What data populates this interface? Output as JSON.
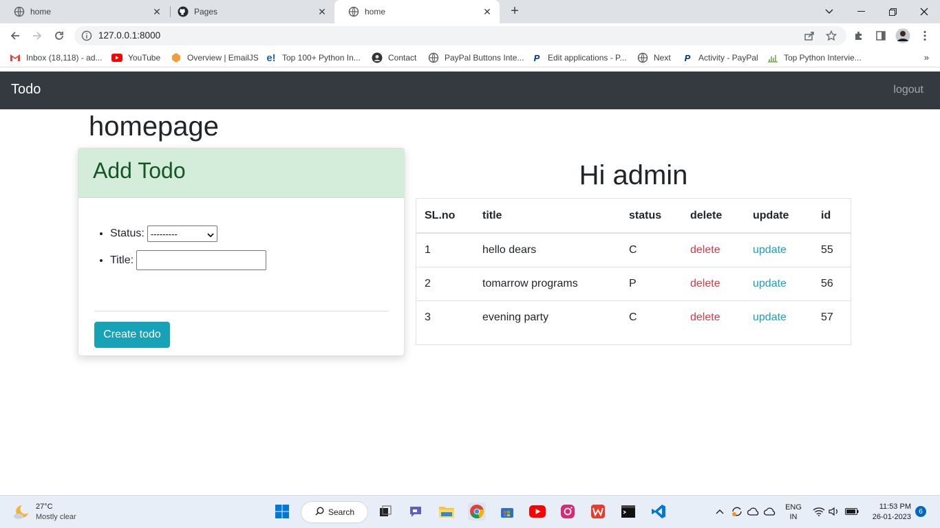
{
  "browser": {
    "tabs": [
      {
        "title": "home",
        "icon": "globe-icon",
        "active": false
      },
      {
        "title": "Pages",
        "icon": "github-icon",
        "active": false
      },
      {
        "title": "home",
        "icon": "globe-icon",
        "active": true
      }
    ],
    "url": "127.0.0.1:8000",
    "bookmarks": [
      {
        "label": "Inbox (18,118) - ad...",
        "icon": "gmail-icon"
      },
      {
        "label": "YouTube",
        "icon": "youtube-icon"
      },
      {
        "label": "Overview | EmailJS",
        "icon": "emailjs-icon"
      },
      {
        "label": "Top 100+ Python In...",
        "icon": "edureka-icon"
      },
      {
        "label": "Contact",
        "icon": "contact-icon"
      },
      {
        "label": "PayPal Buttons Inte...",
        "icon": "globe-icon"
      },
      {
        "label": "Edit applications - P...",
        "icon": "paypal-icon"
      },
      {
        "label": "Next",
        "icon": "globe-icon"
      },
      {
        "label": "Activity - PayPal",
        "icon": "paypal-icon"
      },
      {
        "label": "Top Python Intervie...",
        "icon": "chart-icon"
      }
    ],
    "more_bookmarks": "»"
  },
  "navbar": {
    "brand": "Todo",
    "logout": "logout"
  },
  "page": {
    "title": "homepage"
  },
  "add_todo": {
    "header": "Add Todo",
    "status_label": "Status:",
    "status_value": "---------",
    "title_label": "Title:",
    "title_value": "",
    "submit_label": "Create todo"
  },
  "todos": {
    "greeting": "Hi admin",
    "columns": [
      "SL.no",
      "title",
      "status",
      "delete",
      "update",
      "id"
    ],
    "rows": [
      {
        "sl": "1",
        "title": "hello dears",
        "status": "C",
        "delete": "delete",
        "update": "update",
        "id": "55"
      },
      {
        "sl": "2",
        "title": "tomarrow programs",
        "status": "P",
        "delete": "delete",
        "update": "update",
        "id": "56"
      },
      {
        "sl": "3",
        "title": "evening party",
        "status": "C",
        "delete": "delete",
        "update": "update",
        "id": "57"
      }
    ]
  },
  "taskbar": {
    "weather_temp": "27°C",
    "weather_desc": "Mostly clear",
    "search_label": "Search",
    "language": "ENG",
    "region": "IN",
    "time": "11:53 PM",
    "date": "26-01-2023",
    "notification_count": "6"
  },
  "colors": {
    "navbar_bg": "#343a40",
    "card_header_bg": "#d4edda",
    "card_header_text": "#155724",
    "button_info": "#17a2b8",
    "danger": "#dc3545"
  }
}
